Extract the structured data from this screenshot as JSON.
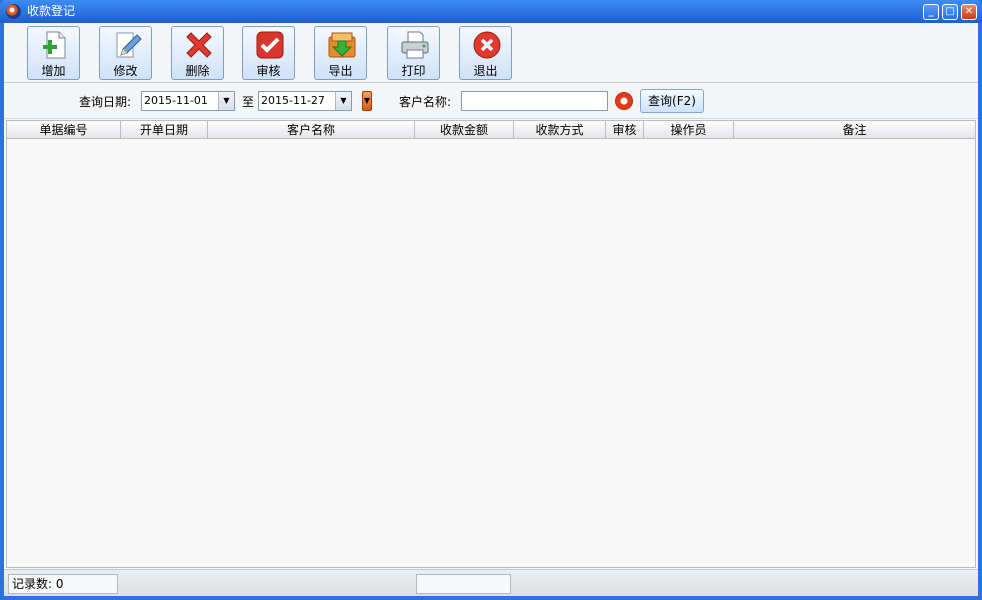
{
  "window": {
    "title": "收款登记",
    "controls": {
      "minimize": "_",
      "maximize": "□",
      "close": "✕"
    }
  },
  "toolbar": {
    "buttons": [
      {
        "label": "增加",
        "icon": "add-document-icon"
      },
      {
        "label": "修改",
        "icon": "edit-pencil-icon"
      },
      {
        "label": "删除",
        "icon": "delete-x-icon"
      },
      {
        "label": "审核",
        "icon": "approve-check-icon"
      },
      {
        "label": "导出",
        "icon": "export-arrow-icon"
      },
      {
        "label": "打印",
        "icon": "printer-icon"
      },
      {
        "label": "退出",
        "icon": "exit-icon"
      }
    ]
  },
  "filter": {
    "date_label": "查询日期:",
    "date_from": "2015-11-01",
    "to_label": "至",
    "date_to": "2015-11-27",
    "customer_label": "客户名称:",
    "customer_value": "",
    "query_button": "查询(F2)"
  },
  "table": {
    "columns": [
      "单据编号",
      "开单日期",
      "客户名称",
      "收款金额",
      "收款方式",
      "审核",
      "操作员",
      "备注"
    ],
    "rows": []
  },
  "status": {
    "record_count": "记录数: 0",
    "middle_panel": ""
  },
  "colors": {
    "titlebar": "#2c73df",
    "client_bg": "#f6f7f9",
    "button_border": "#7a9fc9"
  }
}
